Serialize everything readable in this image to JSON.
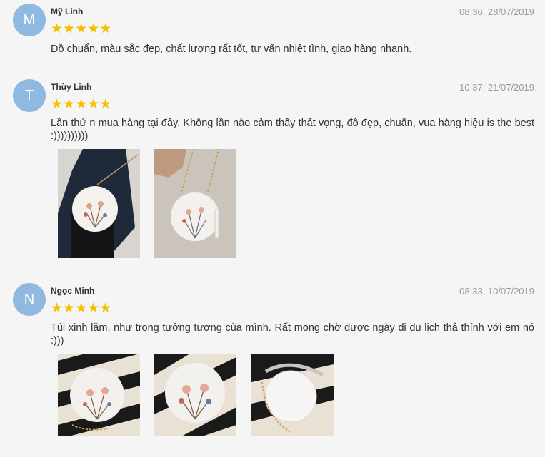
{
  "reviews": [
    {
      "initial": "M",
      "name": "Mỹ Linh",
      "date": "08:36, 28/07/2019",
      "stars": "★★★★★",
      "rating": 5,
      "text": "Đồ chuẩn, màu sắc đẹp, chất lượng rất tốt, tư vấn nhiệt tình, giao hàng nhanh."
    },
    {
      "initial": "T",
      "name": "Thùy Linh",
      "date": "10:37, 21/07/2019",
      "stars": "★★★★★",
      "rating": 5,
      "text": "Lần thứ n mua hàng tại đây. Không lần nào cảm thấy thất vọng, đồ đẹp, chuẩn, vua hàng hiệu is the best :))))))))))",
      "photos": [
        "bag-worn-photo",
        "bag-hanging-photo"
      ]
    },
    {
      "initial": "N",
      "name": "Ngọc Minh",
      "date": "08:33, 10/07/2019",
      "stars": "★★★★★",
      "rating": 5,
      "text": "Túi xinh lắm, như trong tưởng tượng của mình. Rất mong chờ được ngày đi du lịch thả thính với em nó :)))",
      "photos": [
        "bag-front-photo",
        "bag-closeup-photo",
        "bag-back-photo"
      ]
    }
  ],
  "colors": {
    "avatar": "#8fb9e0",
    "star": "#f2c200",
    "date": "#999999"
  }
}
